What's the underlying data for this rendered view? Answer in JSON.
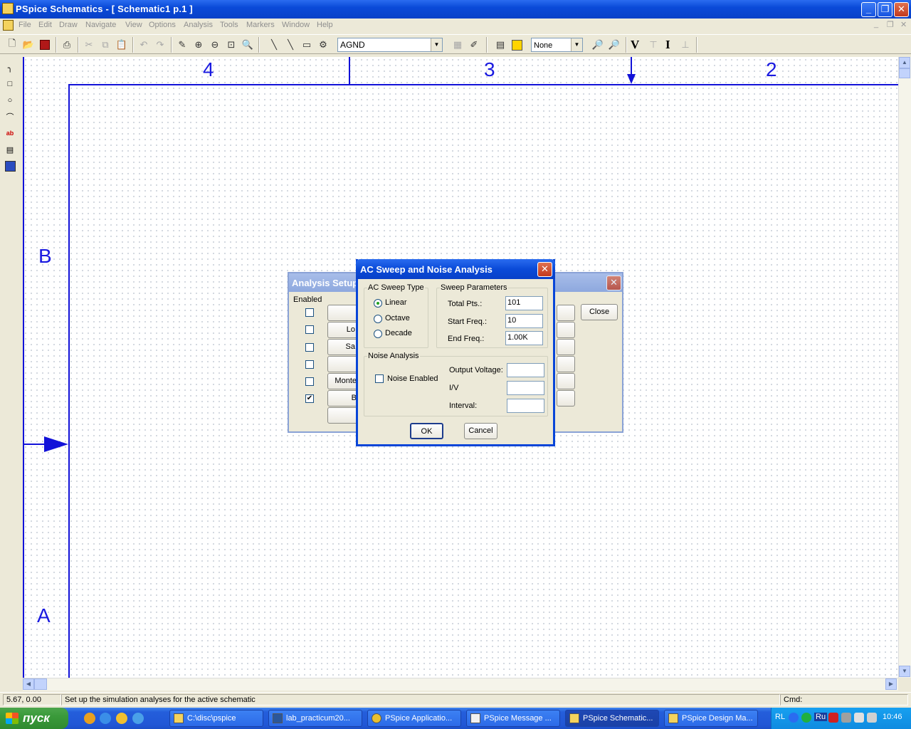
{
  "window": {
    "title": "PSpice Schematics - [ Schematic1  p.1   ]"
  },
  "menu": {
    "items": [
      "File",
      "Edit",
      "Draw",
      "Navigate",
      "View",
      "Options",
      "Analysis",
      "Tools",
      "Markers",
      "Window",
      "Help"
    ]
  },
  "toolbar": {
    "part_combo": "AGND",
    "marker_combo": "None",
    "v_label": "V",
    "i_label": "I"
  },
  "canvas": {
    "col_labels": [
      "4",
      "3",
      "2"
    ],
    "row_labels": [
      "B",
      "A"
    ]
  },
  "status": {
    "coords": "5.67, 0.00",
    "message": "Set up the simulation analyses for the active schematic",
    "cmd_label": "Cmd:"
  },
  "analysis_setup": {
    "title": "Analysis Setup",
    "enabled_header": "Enabled",
    "close_label": "Close",
    "enabled_states": [
      false,
      false,
      false,
      false,
      false,
      true
    ],
    "partial_buttons": [
      "",
      "Lo",
      "Sa",
      "",
      "Monte",
      "B",
      ""
    ]
  },
  "ac_sweep": {
    "title": "AC Sweep and Noise Analysis",
    "sweep_type_group": "AC Sweep Type",
    "sweep_types": [
      "Linear",
      "Octave",
      "Decade"
    ],
    "selected_type": "Linear",
    "sweep_params_group": "Sweep Parameters",
    "total_pts_label": "Total Pts.:",
    "total_pts": "101",
    "start_freq_label": "Start Freq.:",
    "start_freq": "10",
    "end_freq_label": "End Freq.:",
    "end_freq": "1.00K",
    "noise_group": "Noise Analysis",
    "noise_enabled_label": "Noise Enabled",
    "output_voltage_label": "Output Voltage:",
    "output_voltage": "",
    "iv_label": "I/V",
    "iv": "",
    "interval_label": "Interval:",
    "interval": "",
    "ok_label": "OK",
    "cancel_label": "Cancel"
  },
  "taskbar": {
    "start_label": "пуск",
    "tasks": [
      "C:\\disc\\pspice",
      "lab_practicum20...",
      "PSpice Applicatio...",
      "PSpice Message ...",
      "PSpice Schematic...",
      "PSpice Design Ma..."
    ],
    "tray_lang": "RL",
    "tray_kbd": "Ru",
    "clock": "10:46"
  },
  "colors": {
    "border_blue": "#1212d8",
    "titlebar": "#0a4ad8"
  }
}
